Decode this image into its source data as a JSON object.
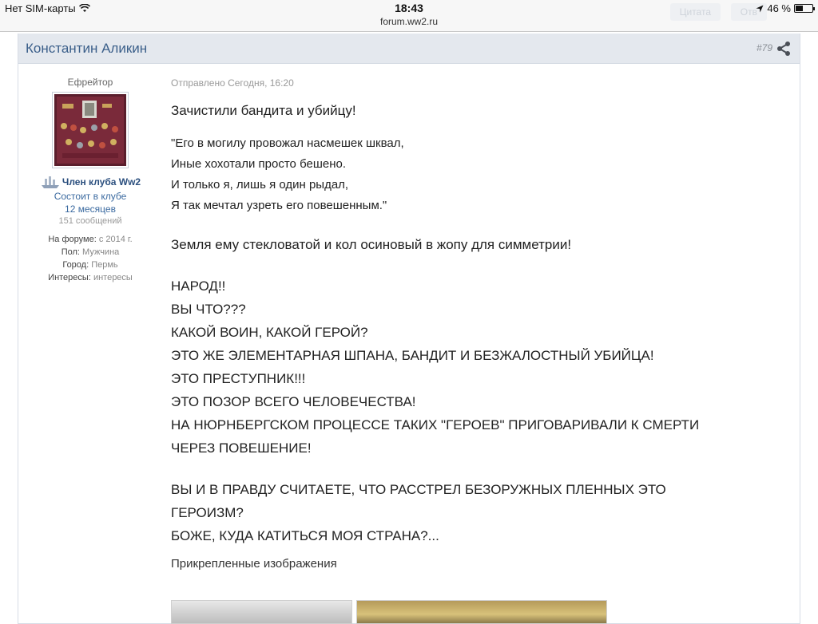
{
  "status_bar": {
    "carrier": "Нет SIM-карты",
    "time": "18:43",
    "url": "forum.ww2.ru",
    "battery": "46 %",
    "battery_level": 0.46,
    "ghost_buttons": [
      "Цитата",
      "Отв"
    ]
  },
  "post": {
    "author": "Константин Аликин",
    "number": "#79",
    "rank": "Ефрейтор",
    "club_title": "Член клуба Ww2",
    "club_line1": "Состоит в клубе",
    "club_line2": "12 месяцев",
    "message_count": "151 сообщений",
    "info": [
      {
        "label": "На форуме:",
        "value": "с 2014 г."
      },
      {
        "label": "Пол:",
        "value": "Мужчина"
      },
      {
        "label": "Город:",
        "value": "Пермь"
      },
      {
        "label": "Интересы:",
        "value": "интересы"
      }
    ],
    "posted": "Отправлено Сегодня, 16:20",
    "p1": "Зачистили бандита и убийцу!",
    "verse": [
      "\"Его в могилу провожал насмешек шквал,",
      "Иные хохотали просто бешено.",
      "И только я, лишь я один рыдал,",
      "Я так мечтал узреть его повешенным.\""
    ],
    "p2": "Земля ему стекловатой и кол осиновый в жопу для симметрии!",
    "caps1": [
      "НАРОД!!",
      "ВЫ ЧТО???",
      "КАКОЙ ВОИН, КАКОЙ ГЕРОЙ?",
      "ЭТО ЖЕ ЭЛЕМЕНТАРНАЯ ШПАНА, БАНДИТ И БЕЗЖАЛОСТНЫЙ УБИЙЦА!",
      "ЭТО ПРЕСТУПНИК!!!",
      "ЭТО ПОЗОР ВСЕГО ЧЕЛОВЕЧЕСТВА!",
      "НА НЮРНБЕРГСКОМ ПРОЦЕССЕ ТАКИХ \"ГЕРОЕВ\" ПРИГОВАРИВАЛИ К СМЕРТИ",
      "ЧЕРЕЗ ПОВЕШЕНИЕ!"
    ],
    "caps2": [
      "ВЫ И В ПРАВДУ СЧИТАЕТЕ, ЧТО РАССТРЕЛ БЕЗОРУЖНЫХ ПЛЕННЫХ ЭТО",
      "ГЕРОИЗМ?",
      "БОЖЕ, КУДА КАТИТЬСЯ МОЯ СТРАНА?..."
    ],
    "attachments_title": "Прикрепленные изображения"
  },
  "icons": {
    "wifi": "wifi-icon",
    "location": "location-arrow-icon",
    "share": "share-icon",
    "club": "ship-icon"
  }
}
